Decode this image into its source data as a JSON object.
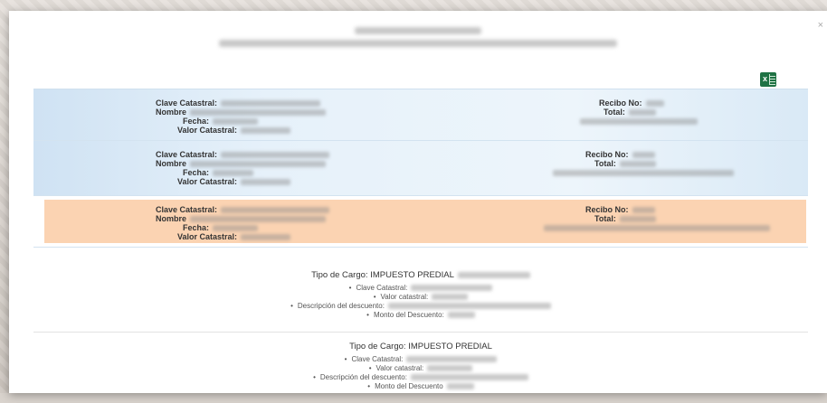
{
  "window": {
    "close_label": "×"
  },
  "excel_icon": {
    "name": "excel-export-icon",
    "glyph": "x",
    "color": "#1f7244"
  },
  "records": [
    {
      "clave_label": "Clave Catastral:",
      "nombre_label": "Nombre",
      "fecha_label": "Fecha:",
      "valor_label": "Valor Catastral:",
      "recibo_label": "Recibo No:",
      "total_label": "Total:"
    },
    {
      "clave_label": "Clave Catastral:",
      "nombre_label": "Nombre",
      "fecha_label": "Fecha:",
      "valor_label": "Valor Catastral:",
      "recibo_label": "Recibo No:",
      "total_label": "Total:"
    },
    {
      "clave_label": "Clave Catastral:",
      "nombre_label": "Nombre",
      "fecha_label": "Fecha:",
      "valor_label": "Valor Catastral:",
      "recibo_label": "Recibo No:",
      "total_label": "Total:"
    }
  ],
  "charges": [
    {
      "tipo": "Tipo de Cargo: IMPUESTO PREDIAL",
      "clave": "Clave Catastral:",
      "valor": "Valor catastral:",
      "descripcion": "Descripción del descuento:",
      "monto": "Monto del Descuento:"
    },
    {
      "tipo": "Tipo de Cargo: IMPUESTO PREDIAL",
      "clave": "Clave Catastral:",
      "valor": "Valor catastral:",
      "descripcion": "Descripción del descuento:",
      "monto": "Monto del Descuento"
    }
  ],
  "colors": {
    "selected_row": "#fbd3b2",
    "row_blue": "#cfe2f3",
    "excel_green": "#1f7244"
  }
}
